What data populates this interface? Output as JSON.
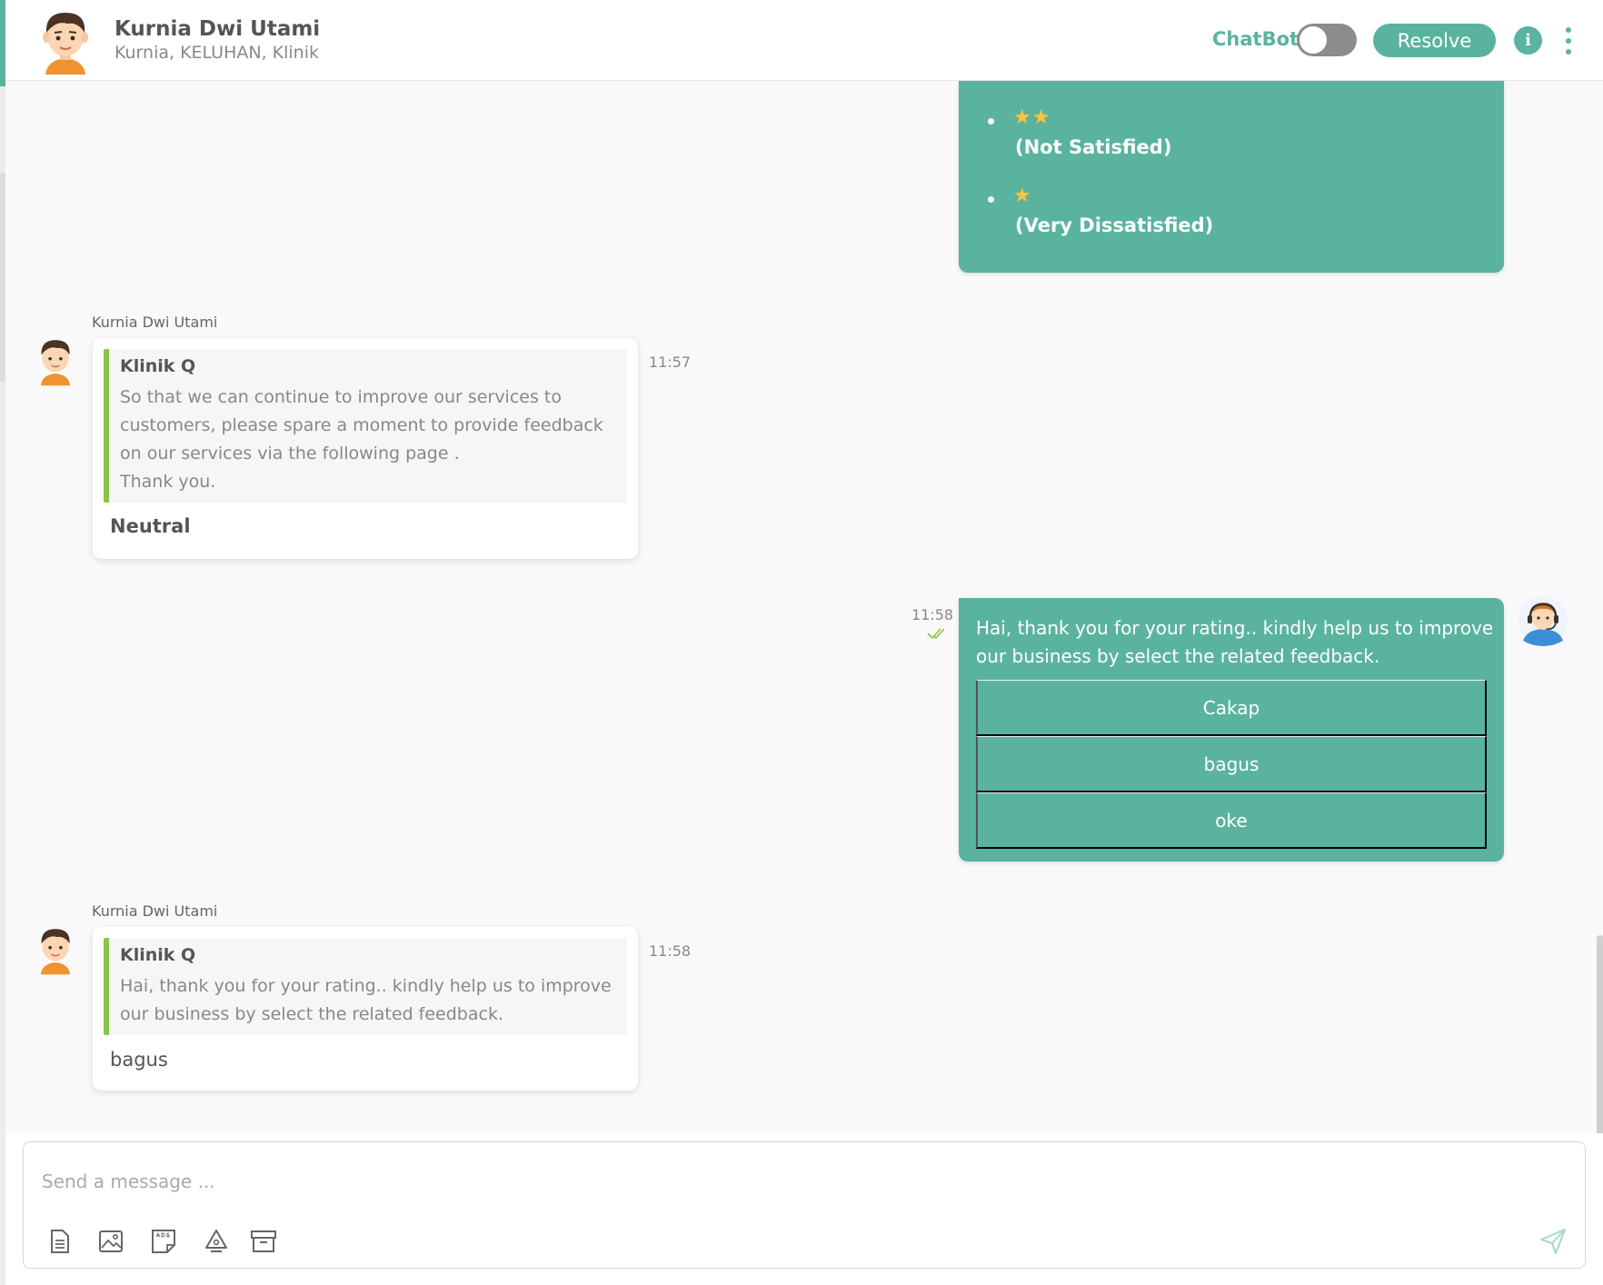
{
  "header": {
    "name": "Kurnia Dwi Utami",
    "subtitle": "Kurnia, KELUHAN, Klinik",
    "chatbot_label": "ChatBot",
    "resolve_label": "Resolve",
    "info_label": "i"
  },
  "rating_options": [
    {
      "stars": "★★",
      "label": "(Not Satisfied)"
    },
    {
      "stars": "★",
      "label": "(Very Dissatisfied)"
    }
  ],
  "messages": [
    {
      "sender": "Kurnia Dwi Utami",
      "time": "11:57",
      "quote_title": "Klinik Q",
      "quote_text": "So that we can continue to improve our services to customers, please spare a moment to provide feedback on our services via the following page .\nThank you.",
      "reply": "Neutral"
    },
    {
      "time": "11:58",
      "text": "Hai, thank you for your rating.. kindly help us to improve our business by select the related feedback.",
      "options": [
        "Cakap",
        "bagus",
        "oke"
      ]
    },
    {
      "sender": "Kurnia Dwi Utami",
      "time": "11:58",
      "quote_title": "Klinik Q",
      "quote_text": "Hai, thank you for your rating.. kindly help us to improve our business by select the related feedback.",
      "reply": "bagus"
    }
  ],
  "composer": {
    "placeholder": "Send a message ..."
  },
  "colors": {
    "accent": "#5ab39f",
    "quote_border": "#8bc34a",
    "star": "#f6c544"
  }
}
